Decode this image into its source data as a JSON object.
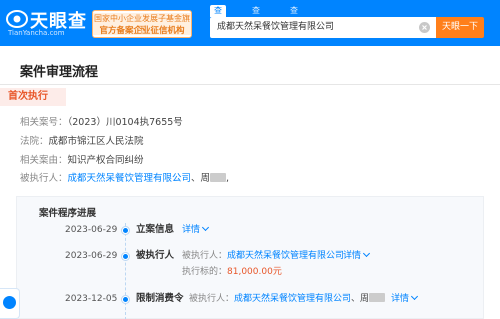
{
  "header": {
    "logo_text": "天眼查",
    "logo_domain": "TianYancha.com",
    "official_line1": "国家中小企业发展子基金旗下",
    "official_line2": "官方备案企业征信机构",
    "tabs": [
      {
        "label": "查公司",
        "active": true
      },
      {
        "label": "查老板",
        "active": false
      },
      {
        "label": "查关系",
        "active": false
      }
    ],
    "search_value": "成都天然呆餐饮管理有限公司",
    "search_button": "天眼一下",
    "brand_color": "#0084ff",
    "button_color": "#ff7f1a"
  },
  "page": {
    "title": "案件审理流程",
    "section_badge": "首次执行"
  },
  "case_info": [
    {
      "label": "相关案号：",
      "value": "（2023）川0104执7655号"
    },
    {
      "label": "法院：",
      "value": "成都市锦江区人民法院"
    },
    {
      "label": "相关案由：",
      "value": "知识产权合同纠纷"
    },
    {
      "label": "被执行人：",
      "link": "成都天然呆餐饮管理有限公司",
      "value": "、周"
    }
  ],
  "process": {
    "title": "案件程序进展",
    "events": [
      {
        "date": "2023-06-29",
        "type": "立案信息",
        "detail_link": "详情"
      },
      {
        "date": "2023-06-29",
        "type": "被执行人",
        "detail_label": "被执行人：",
        "detail_entity": "成都天然呆餐饮管理有限公司",
        "detail_link": "详情",
        "amount_label": "执行标的：",
        "amount": "81,000.00元"
      },
      {
        "date": "2023-12-05",
        "type": "限制消费令",
        "detail_label": "被执行人：",
        "detail_entity": "成都天然呆餐饮管理有限公司",
        "detail_tail": "、周",
        "detail_link": "详情"
      }
    ]
  }
}
